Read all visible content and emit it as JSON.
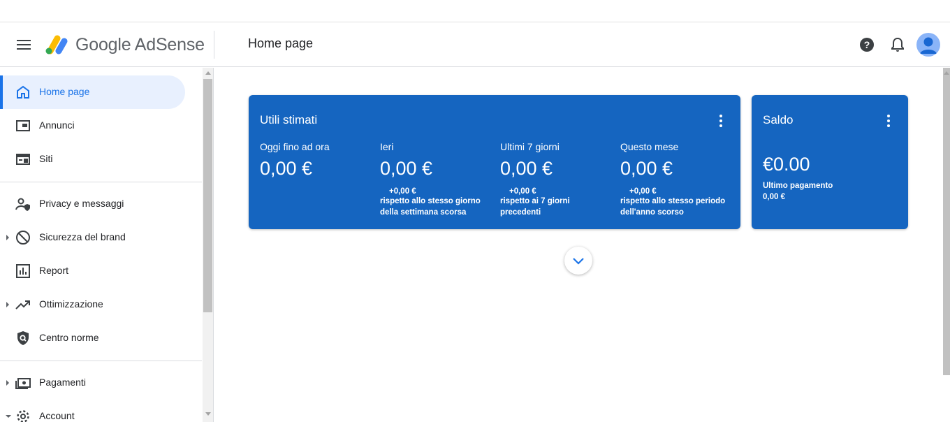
{
  "header": {
    "brand": "Google AdSense",
    "page_title": "Home page"
  },
  "sidebar": {
    "items": [
      {
        "label": "Home page",
        "icon": "home-icon"
      },
      {
        "label": "Annunci",
        "icon": "ads-icon"
      },
      {
        "label": "Siti",
        "icon": "sites-icon"
      },
      {
        "label": "Privacy e messaggi",
        "icon": "privacy-icon"
      },
      {
        "label": "Sicurezza del brand",
        "icon": "block-icon"
      },
      {
        "label": "Report",
        "icon": "report-icon"
      },
      {
        "label": "Ottimizzazione",
        "icon": "trending-icon"
      },
      {
        "label": "Centro norme",
        "icon": "policy-shield-icon"
      },
      {
        "label": "Pagamenti",
        "icon": "payments-icon"
      },
      {
        "label": "Account",
        "icon": "gear-icon"
      }
    ]
  },
  "earnings_card": {
    "title": "Utili stimati",
    "metrics": [
      {
        "label": "Oggi fino ad ora",
        "value": "0,00 €",
        "delta": "",
        "desc": ""
      },
      {
        "label": "Ieri",
        "value": "0,00 €",
        "delta": "+0,00 €",
        "desc": "rispetto allo stesso giorno della settimana scorsa"
      },
      {
        "label": "Ultimi 7 giorni",
        "value": "0,00 €",
        "delta": "+0,00 €",
        "desc": "rispetto ai 7 giorni precedenti"
      },
      {
        "label": "Questo mese",
        "value": "0,00 €",
        "delta": "+0,00 €",
        "desc": "rispetto allo stesso periodo dell'anno scorso"
      }
    ]
  },
  "balance_card": {
    "title": "Saldo",
    "value": "€0.00",
    "last_payment_label": "Ultimo pagamento",
    "last_payment_value": "0,00 €"
  },
  "colors": {
    "card_blue": "#1565c0",
    "accent": "#1a73e8"
  }
}
